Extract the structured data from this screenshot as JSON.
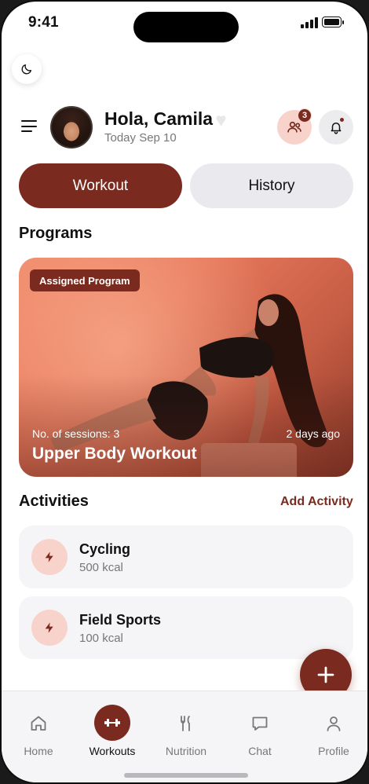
{
  "status_bar": {
    "time": "9:41"
  },
  "header": {
    "greeting": "Hola, Camila",
    "date": "Today Sep 10",
    "group_badge_count": "3"
  },
  "segments": {
    "workout_label": "Workout",
    "history_label": "History",
    "active": "Workout"
  },
  "programs": {
    "section_title": "Programs",
    "card": {
      "tag": "Assigned Program",
      "sessions": "No. of sessions: 3",
      "time_ago": "2 days ago",
      "name": "Upper Body Workout"
    }
  },
  "activities": {
    "section_title": "Activities",
    "add_label": "Add Activity",
    "items": [
      {
        "name": "Cycling",
        "kcal": "500 kcal",
        "icon": "bolt-icon"
      },
      {
        "name": "Field Sports",
        "kcal": "100 kcal",
        "icon": "bolt-icon"
      }
    ]
  },
  "tabbar": {
    "items": [
      {
        "label": "Home",
        "icon": "home-icon"
      },
      {
        "label": "Workouts",
        "icon": "dumbbell-icon",
        "active": true
      },
      {
        "label": "Nutrition",
        "icon": "utensils-icon"
      },
      {
        "label": "Chat",
        "icon": "chat-icon"
      },
      {
        "label": "Profile",
        "icon": "person-icon"
      }
    ]
  },
  "colors": {
    "accent": "#7a2a1e",
    "accent_soft": "#f8d3cb",
    "surface": "#f5f5f7"
  }
}
